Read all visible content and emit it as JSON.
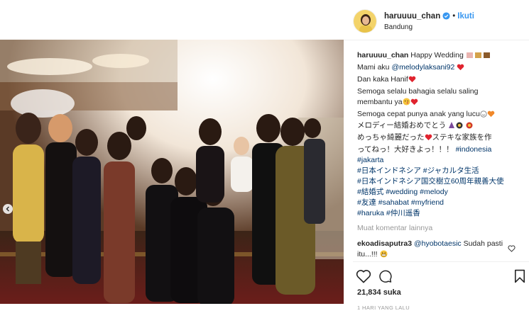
{
  "post": {
    "username": "haruuuu_chan",
    "follow_label": "Ikuti",
    "location": "Bandung"
  },
  "caption": {
    "username": "haruuuu_chan",
    "l1": "Happy Wedding",
    "l2": "Mami aku",
    "mention1": "@melodylaksani92",
    "l3": "Dan kaka Hanif",
    "l4": "Semoga selalu bahagia selalu saling",
    "l5": "membantu ya",
    "l6": "Semoga cepat punya anak yang lucu",
    "l7": "メロディー結婚おめでとう",
    "l8a": "めっちゃ綺麗だった",
    "l8b": "ステキな家族を作",
    "l9": "ってねっ！大好きよっ！！！",
    "tag_indonesia": "#indonesia",
    "tag_jakarta": "#jakarta",
    "tag_jp_indonesia": "#日本インドネシア",
    "tag_jakarta_life": "#ジャカルタ生活",
    "tag_60th": "#日本インドネシア国交樹立60周年親善大使",
    "tag_wedding_jp": "#結婚式",
    "tag_wedding": "#wedding",
    "tag_melody": "#melody",
    "tag_friend_jp": "#友達",
    "tag_sahabat": "#sahabat",
    "tag_myfriend": "#myfriend",
    "tag_haruka": "#haruka",
    "tag_name": "#仲川遥香"
  },
  "comments": {
    "more_label": "Muat komentar lainnya",
    "c1_username": "ekoadisaputra3",
    "c1_mention": "@hyobotaesic",
    "c1_text": "Sudah pasti itu...!!!"
  },
  "stats": {
    "likes": "21,834",
    "likes_suffix": "suka",
    "time": "1 HARI YANG LALU"
  },
  "colors": {
    "link": "#003569",
    "follow": "#3897f0",
    "verified": "#3897f0",
    "muted": "#999999",
    "heart": "#ed4956"
  },
  "icons": [
    "chevron-left-icon",
    "verified-badge-icon",
    "heart-icon",
    "comment-icon",
    "bookmark-icon",
    "like-small-icon"
  ]
}
